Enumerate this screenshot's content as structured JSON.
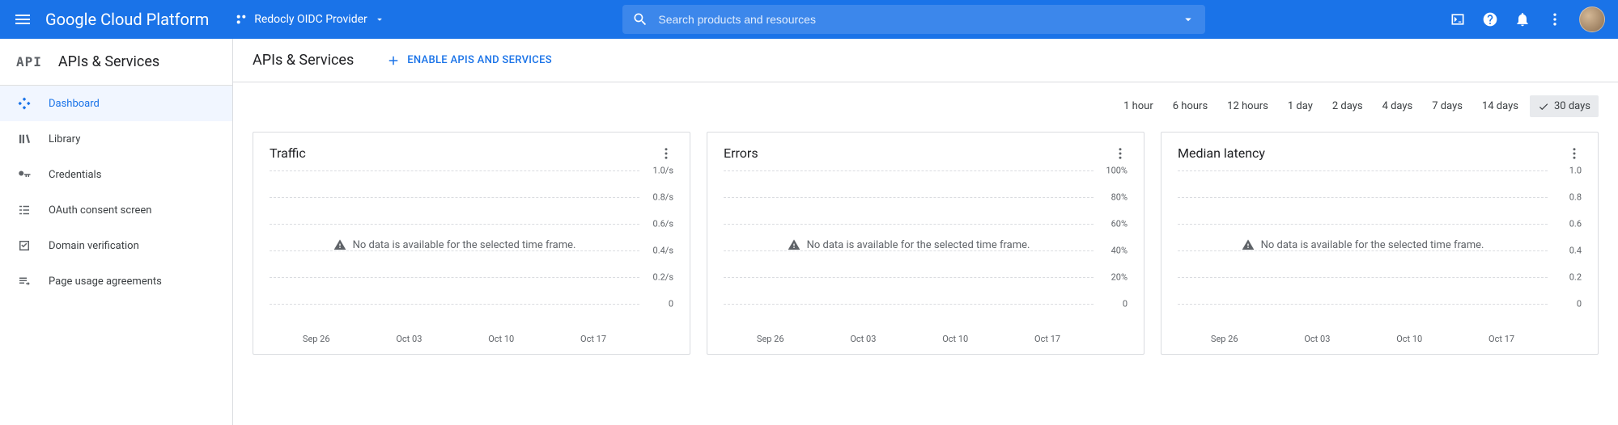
{
  "header": {
    "logo": "Google Cloud Platform",
    "project": "Redocly OIDC Provider",
    "search_placeholder": "Search products and resources"
  },
  "sidenav": {
    "section_logo": "API",
    "section_title": "APIs & Services",
    "items": [
      {
        "label": "Dashboard"
      },
      {
        "label": "Library"
      },
      {
        "label": "Credentials"
      },
      {
        "label": "OAuth consent screen"
      },
      {
        "label": "Domain verification"
      },
      {
        "label": "Page usage agreements"
      }
    ]
  },
  "main": {
    "title": "APIs & Services",
    "enable_label": "ENABLE APIS AND SERVICES"
  },
  "time_ranges": [
    "1 hour",
    "6 hours",
    "12 hours",
    "1 day",
    "2 days",
    "4 days",
    "7 days",
    "14 days",
    "30 days"
  ],
  "time_selected": "30 days",
  "cards": [
    {
      "title": "Traffic",
      "nodata": "No data is available for the selected time frame."
    },
    {
      "title": "Errors",
      "nodata": "No data is available for the selected time frame."
    },
    {
      "title": "Median latency",
      "nodata": "No data is available for the selected time frame."
    }
  ],
  "chart_data": [
    {
      "type": "line",
      "title": "Traffic",
      "series": [],
      "x_ticks": [
        "Sep 26",
        "Oct 03",
        "Oct 10",
        "Oct 17"
      ],
      "y_ticks": [
        "1.0/s",
        "0.8/s",
        "0.6/s",
        "0.4/s",
        "0.2/s",
        "0"
      ],
      "ylim": [
        0,
        1.0
      ],
      "yunit": "/s",
      "nodata": true
    },
    {
      "type": "line",
      "title": "Errors",
      "series": [],
      "x_ticks": [
        "Sep 26",
        "Oct 03",
        "Oct 10",
        "Oct 17"
      ],
      "y_ticks": [
        "100%",
        "80%",
        "60%",
        "40%",
        "20%",
        "0"
      ],
      "ylim": [
        0,
        100
      ],
      "yunit": "%",
      "nodata": true
    },
    {
      "type": "line",
      "title": "Median latency",
      "series": [],
      "x_ticks": [
        "Sep 26",
        "Oct 03",
        "Oct 10",
        "Oct 17"
      ],
      "y_ticks": [
        "1.0",
        "0.8",
        "0.6",
        "0.4",
        "0.2",
        "0"
      ],
      "ylim": [
        0,
        1.0
      ],
      "yunit": "",
      "nodata": true
    }
  ]
}
